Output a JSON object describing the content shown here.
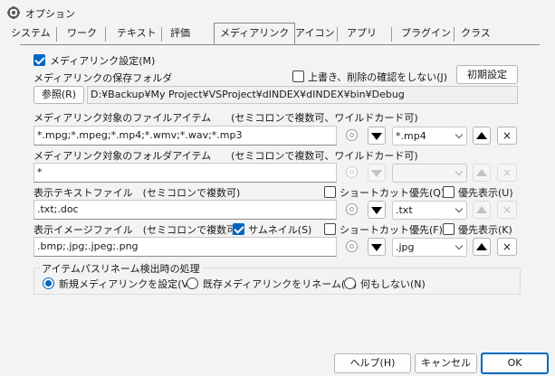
{
  "window": {
    "title": "オプション"
  },
  "tabs": [
    {
      "label": "システム"
    },
    {
      "label": "ワーク"
    },
    {
      "label": "テキスト"
    },
    {
      "label": "評価"
    },
    {
      "label": "メディアリンク"
    },
    {
      "label": "アイコン"
    },
    {
      "label": "アプリ"
    },
    {
      "label": "プラグイン"
    },
    {
      "label": "クラス"
    }
  ],
  "media": {
    "enable_label": "メディアリンク設定(M)",
    "enable_checked": true,
    "folder_label": "メディアリンクの保存フォルダ",
    "no_confirm_label": "上書き、削除の確認をしない(J)",
    "no_confirm_checked": false,
    "reset_button": "初期設定",
    "browse_button": "参照(R)",
    "folder_path": "D:¥Backup¥My Project¥VSProject¥dINDEX¥dINDEX¥bin¥Debug",
    "file_items_label": "メディアリンク対象のファイルアイテム　　(セミコロンで複数可、ワイルドカード可)",
    "file_items_value": "*.mpg;*.mpeg;*.mp4;*.wmv;*.wav;*.mp3",
    "file_items_combo": "*.mp4",
    "folder_items_label": "メディアリンク対象のフォルダアイテム　　(セミコロンで複数可、ワイルドカード可)",
    "folder_items_value": "*",
    "folder_items_combo": "",
    "text_files_label": "表示テキストファイル　(セミコロンで複数可)",
    "text_shortcut_label": "ショートカット優先(Q)",
    "text_priority_label": "優先表示(U)",
    "text_files_value": ".txt;.doc",
    "text_files_combo": ".txt",
    "image_files_label": "表示イメージファイル　(セミコロンで複数可)",
    "thumbnail_label": "サムネイル(S)",
    "thumbnail_checked": true,
    "image_shortcut_label": "ショートカット優先(F)",
    "image_priority_label": "優先表示(K)",
    "image_files_value": ".bmp;.jpg;.jpeg;.png",
    "image_files_combo": ".jpg"
  },
  "rename": {
    "group_label": "アイテムパスリネーム検出時の処理",
    "options": [
      {
        "label": "新規メディアリンクを設定(V)",
        "selected": true
      },
      {
        "label": "既存メディアリンクをリネーム(O)",
        "selected": false
      },
      {
        "label": "何もしない(N)",
        "selected": false
      }
    ]
  },
  "footer": {
    "help": "ヘルプ(H)",
    "cancel": "キャンセル",
    "ok": "OK"
  },
  "colors": {
    "accent": "#0067c0",
    "background": "#f3f3f3"
  }
}
